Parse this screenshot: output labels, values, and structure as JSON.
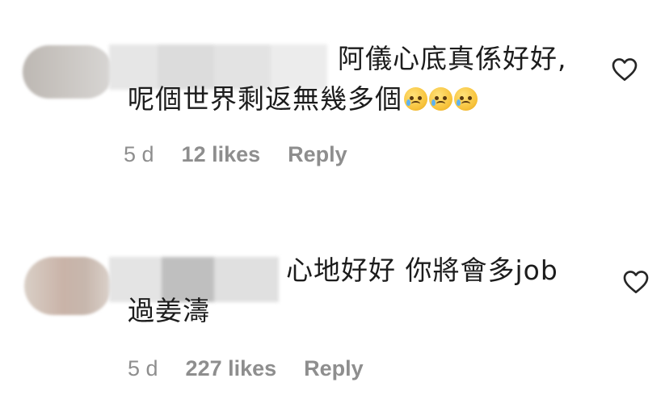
{
  "comments": [
    {
      "text_lines": [
        "阿儀心底真係好好,",
        "呢個世界剩返無幾多個"
      ],
      "emojis": [
        "crying-face-emoji",
        "crying-face-emoji",
        "crying-face-emoji"
      ],
      "time": "5 d",
      "likes": "12 likes",
      "reply": "Reply"
    },
    {
      "text_lines": [
        "心地好好 你將會多job",
        "過姜濤"
      ],
      "emojis": [],
      "time": "5 d",
      "likes": "227 likes",
      "reply": "Reply"
    }
  ],
  "colors": {
    "text": "#1c1c1c",
    "meta": "#8e8e8e",
    "heart_stroke": "#262626",
    "background": "#ffffff"
  },
  "icons": {
    "like": "heart-outline-icon",
    "emoji": "crying-face-emoji"
  }
}
